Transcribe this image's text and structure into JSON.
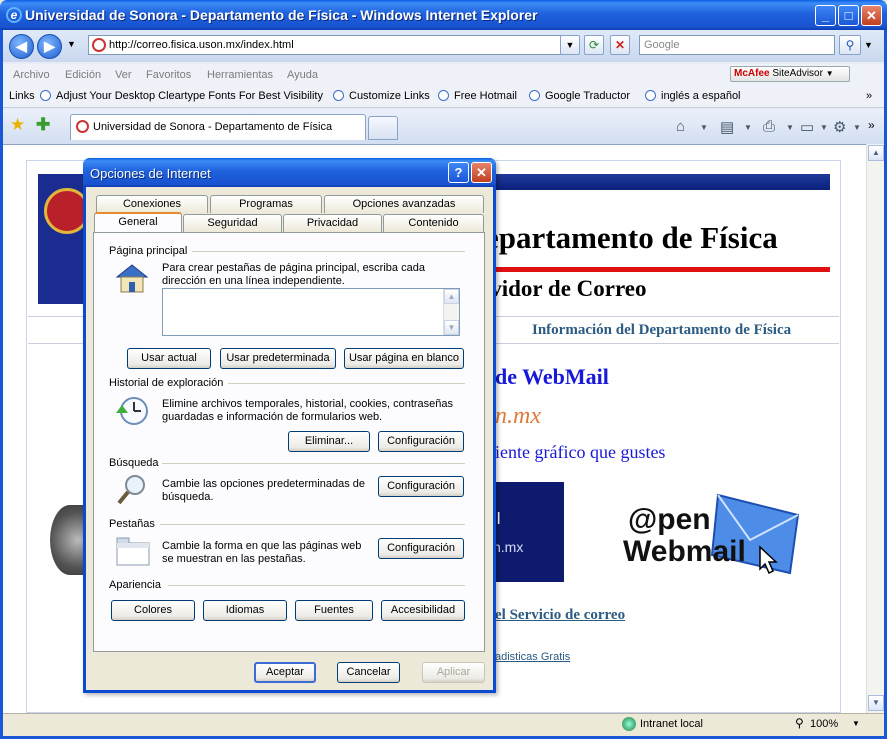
{
  "window": {
    "title": "Universidad de Sonora - Departamento de Física - Windows Internet Explorer",
    "minimize": "_",
    "maximize": "□",
    "close": "✕"
  },
  "nav": {
    "back": "◀",
    "forward": "▶",
    "address": "http://correo.fisica.uson.mx/index.html",
    "search_placeholder": "Google"
  },
  "menu": [
    "Archivo",
    "Edición",
    "Ver",
    "Favoritos",
    "Herramientas",
    "Ayuda"
  ],
  "mcafee": {
    "brand": "McAfee",
    "product": "SiteAdvisor"
  },
  "links": {
    "label": "Links",
    "items": [
      "Adjust Your Desktop Cleartype Fonts For Best Visibility",
      "Customize Links",
      "Free Hotmail",
      "Google Traductor",
      "inglés a español"
    ]
  },
  "tab": {
    "title": "Universidad de Sonora - Departamento de Física"
  },
  "page": {
    "title": "epartamento de Física",
    "subtitle": "rvidor de Correo",
    "info_link": "Información del Departamento de Física",
    "webmail_heading": "de WebMail",
    "domain_fragment": "n.mx",
    "client_text": "iente gráfico que gustes",
    "navy_text1": "il",
    "navy_text2": "n.mx",
    "openwebmail_line1": "@pen",
    "openwebmail_line2": "Webmail",
    "service_link": "el Servicio de correo",
    "stats_link": "adisticas Gratis"
  },
  "status": {
    "zone": "Intranet local",
    "zoom": "100%"
  },
  "dialog": {
    "title": "Opciones de Internet",
    "help": "?",
    "close": "✕",
    "tabs_back": [
      "Conexiones",
      "Programas",
      "Opciones avanzadas"
    ],
    "tabs_front": [
      "General",
      "Seguridad",
      "Privacidad",
      "Contenido"
    ],
    "home": {
      "label": "Página principal",
      "desc": "Para crear pestañas de página principal, escriba cada dirección en una línea independiente.",
      "buttons": [
        "Usar actual",
        "Usar predeterminada",
        "Usar página en blanco"
      ]
    },
    "history": {
      "label": "Historial de exploración",
      "desc": "Elimine archivos temporales, historial, cookies, contraseñas guardadas e información de formularios web.",
      "delete": "Eliminar...",
      "config": "Configuración"
    },
    "search": {
      "label": "Búsqueda",
      "desc": "Cambie las opciones predeterminadas de búsqueda.",
      "config": "Configuración"
    },
    "tabs_section": {
      "label": "Pestañas",
      "desc": "Cambie la forma en que las páginas web se muestran en las pestañas.",
      "config": "Configuración"
    },
    "appearance": {
      "label": "Apariencia",
      "buttons": [
        "Colores",
        "Idiomas",
        "Fuentes",
        "Accesibilidad"
      ]
    },
    "footer": {
      "ok": "Aceptar",
      "cancel": "Cancelar",
      "apply": "Aplicar"
    }
  }
}
